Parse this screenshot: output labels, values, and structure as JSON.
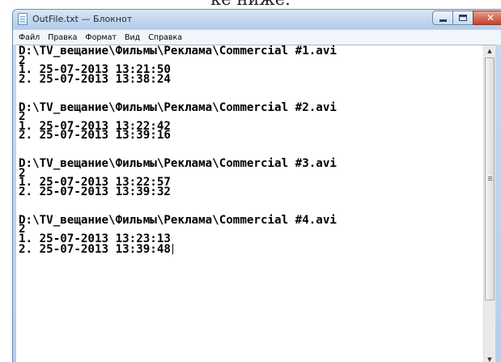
{
  "doc_fragment": "ке ниже.",
  "window": {
    "title": "OutFile.txt — Блокнот",
    "icon": "notepad-icon",
    "controls": {
      "minimize": "minimize-icon",
      "maximize": "maximize-icon",
      "close": "✕"
    }
  },
  "menu": [
    "Файл",
    "Правка",
    "Формат",
    "Вид",
    "Справка"
  ],
  "lines": [
    "D:\\TV_вещание\\Фильмы\\Реклама\\Commercial #1.avi",
    "2",
    "1. 25-07-2013 13:21:50",
    "2. 25-07-2013 13:38:24",
    "",
    "",
    "D:\\TV_вещание\\Фильмы\\Реклама\\Commercial #2.avi",
    "2",
    "1. 25-07-2013 13:22:42",
    "2. 25-07-2013 13:39:16",
    "",
    "",
    "D:\\TV_вещание\\Фильмы\\Реклама\\Commercial #3.avi",
    "2",
    "1. 25-07-2013 13:22:57",
    "2. 25-07-2013 13:39:32",
    "",
    "",
    "D:\\TV_вещание\\Фильмы\\Реклама\\Commercial #4.avi",
    "2",
    "1. 25-07-2013 13:23:13",
    "2. 25-07-2013 13:39:48"
  ],
  "scrollbar": {
    "up_arrow": "▲",
    "down_arrow": "▼"
  }
}
